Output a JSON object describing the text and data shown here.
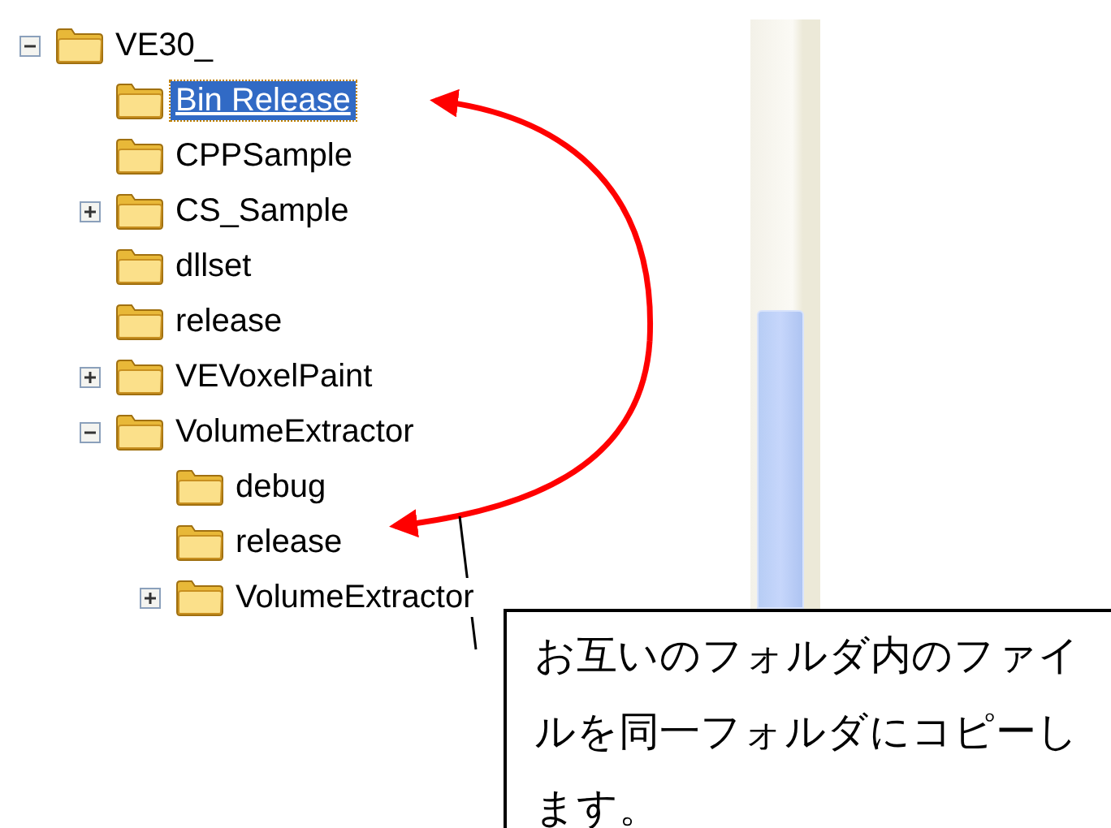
{
  "tree": [
    {
      "label": "VE30_",
      "expanded": true,
      "selected": false,
      "children": [
        {
          "label": "Bin Release",
          "selected": true
        },
        {
          "label": "CPPSample",
          "selected": false
        },
        {
          "label": "CS_Sample",
          "expanded": false,
          "selected": false
        },
        {
          "label": "dllset",
          "selected": false
        },
        {
          "label": "release",
          "selected": false
        },
        {
          "label": "VEVoxelPaint",
          "expanded": false,
          "selected": false
        },
        {
          "label": "VolumeExtractor",
          "expanded": true,
          "selected": false,
          "children": [
            {
              "label": "debug",
              "selected": false
            },
            {
              "label": "release",
              "selected": false
            },
            {
              "label": "VolumeExtractor",
              "expanded": false,
              "selected": false
            }
          ]
        }
      ]
    }
  ],
  "callout": {
    "text": "お互いのフォルダ内のファイルを同一フォルダにコピーします。"
  }
}
